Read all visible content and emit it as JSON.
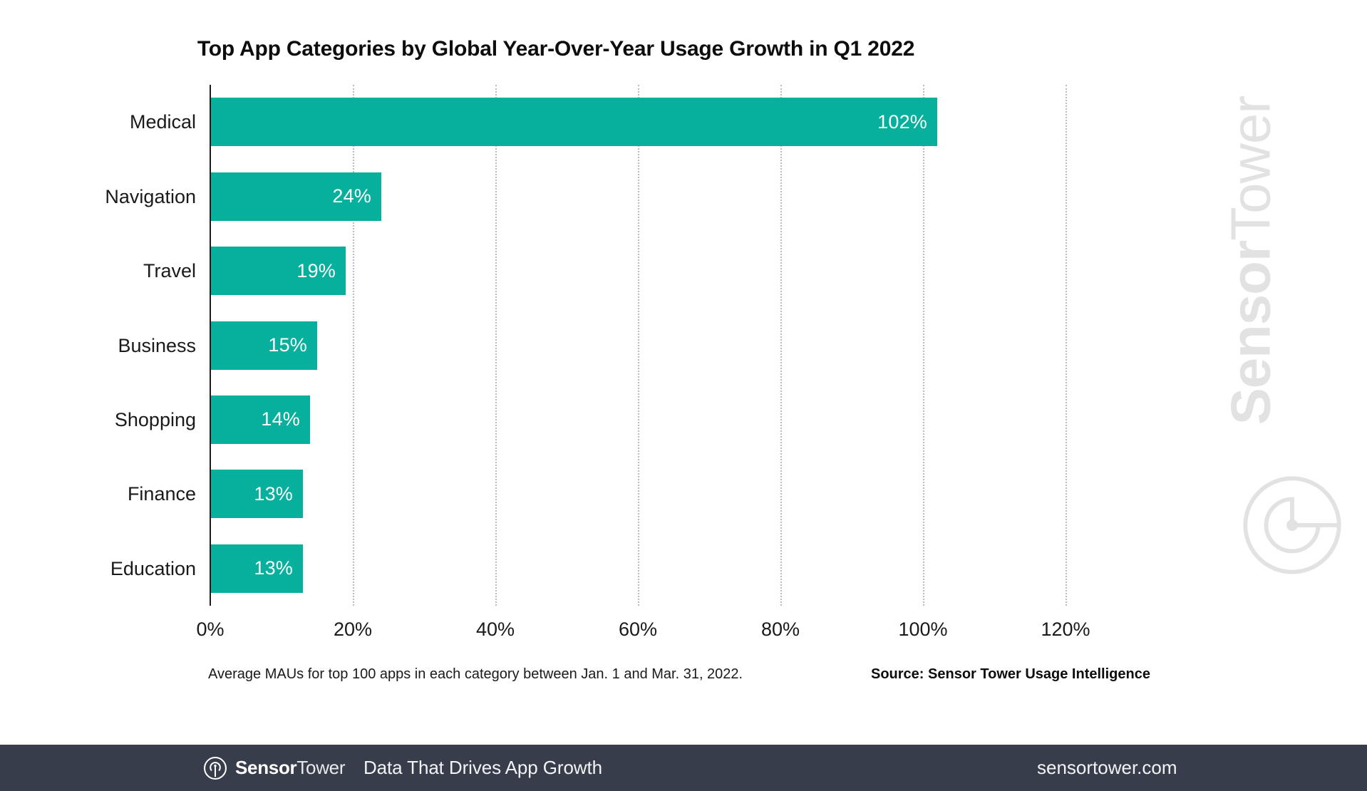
{
  "chart_data": {
    "type": "bar",
    "orientation": "horizontal",
    "title": "Top App Categories by Global Year-Over-Year Usage Growth in Q1 2022",
    "categories": [
      "Medical",
      "Navigation",
      "Travel",
      "Business",
      "Shopping",
      "Finance",
      "Education"
    ],
    "values": [
      102,
      24,
      19,
      15,
      14,
      13,
      13
    ],
    "value_labels": [
      "102%",
      "24%",
      "19%",
      "15%",
      "14%",
      "13%",
      "13%"
    ],
    "xlabel": "",
    "ylabel": "",
    "xlim": [
      0,
      130
    ],
    "xticks": [
      0,
      20,
      40,
      60,
      80,
      100,
      120
    ],
    "xtick_labels": [
      "0%",
      "20%",
      "40%",
      "60%",
      "80%",
      "100%",
      "120%"
    ],
    "grid": "vertical-dotted",
    "legend": "none",
    "bar_color": "#06b09d",
    "value_label_color": "#ffffff",
    "axis_color": "#1c1c1c",
    "gridline_color": "#b9b9b9",
    "footnote": "Average MAUs for top 100 apps in each category between Jan. 1 and Mar. 31, 2022.",
    "source": "Source: Sensor Tower Usage Intelligence"
  },
  "watermark": {
    "brand_bold": "Sensor",
    "brand_light": "Tower",
    "color": "#e2e2e2"
  },
  "footer": {
    "background": "#373d4b",
    "brand_bold": "Sensor",
    "brand_light": "Tower",
    "tagline": "Data That Drives App Growth",
    "url": "sensortower.com"
  }
}
